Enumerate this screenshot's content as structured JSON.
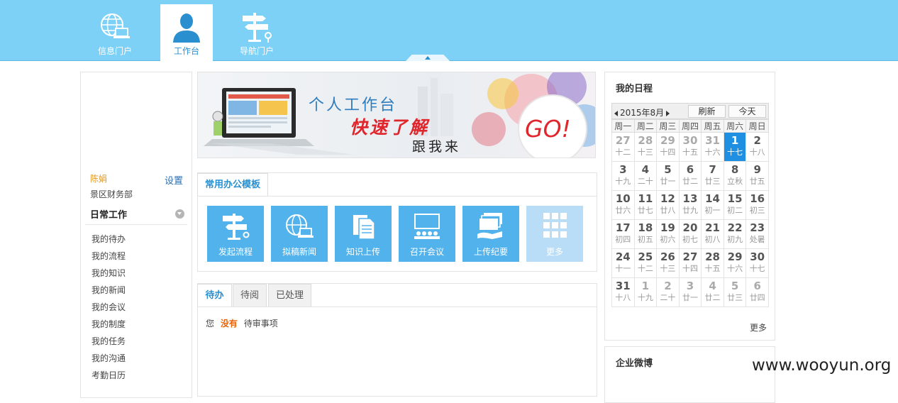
{
  "nav": {
    "tabs": [
      {
        "label": "信息门户",
        "icon": "globe-laptop-icon"
      },
      {
        "label": "工作台",
        "icon": "user-icon",
        "active": true
      },
      {
        "label": "导航门户",
        "icon": "signpost-icon"
      }
    ]
  },
  "user": {
    "name": "陈娟",
    "settings": "设置",
    "dept": "景区财务部"
  },
  "sidebar": {
    "section": "日常工作",
    "items": [
      "我的待办",
      "我的流程",
      "我的知识",
      "我的新闻",
      "我的会议",
      "我的制度",
      "我的任务",
      "我的沟通",
      "考勤日历"
    ]
  },
  "banner": {
    "line1": "个人工作台",
    "line2": "快速了解",
    "line3": "跟我来",
    "go": "GO!"
  },
  "templates": {
    "title": "常用办公模板",
    "tiles": [
      {
        "label": "发起流程",
        "icon": "signpost-icon"
      },
      {
        "label": "拟稿新闻",
        "icon": "globe-laptop-icon"
      },
      {
        "label": "知识上传",
        "icon": "document-icon"
      },
      {
        "label": "召开会议",
        "icon": "meeting-icon"
      },
      {
        "label": "上传纪要",
        "icon": "upload-minutes-icon"
      },
      {
        "label": "更多",
        "icon": "grid-icon"
      }
    ]
  },
  "tasks": {
    "tabs": [
      "待办",
      "待阅",
      "已处理"
    ],
    "msg_prefix": "您",
    "msg_highlight": "没有",
    "msg_suffix": "待审事项"
  },
  "schedule": {
    "title": "我的日程",
    "month": "2015年8月",
    "refresh": "刷新",
    "today": "今天",
    "weekdays": [
      "周一",
      "周二",
      "周三",
      "周四",
      "周五",
      "周六",
      "周日"
    ],
    "weeks": [
      [
        {
          "d": "27",
          "l": "十二",
          "o": true
        },
        {
          "d": "28",
          "l": "十三",
          "o": true
        },
        {
          "d": "29",
          "l": "十四",
          "o": true
        },
        {
          "d": "30",
          "l": "十五",
          "o": true
        },
        {
          "d": "31",
          "l": "十六",
          "o": true
        },
        {
          "d": "1",
          "l": "十七",
          "t": true
        },
        {
          "d": "2",
          "l": "十八"
        }
      ],
      [
        {
          "d": "3",
          "l": "十九"
        },
        {
          "d": "4",
          "l": "二十"
        },
        {
          "d": "5",
          "l": "廿一"
        },
        {
          "d": "6",
          "l": "廿二"
        },
        {
          "d": "7",
          "l": "廿三"
        },
        {
          "d": "8",
          "l": "立秋"
        },
        {
          "d": "9",
          "l": "廿五"
        }
      ],
      [
        {
          "d": "10",
          "l": "廿六"
        },
        {
          "d": "11",
          "l": "廿七"
        },
        {
          "d": "12",
          "l": "廿八"
        },
        {
          "d": "13",
          "l": "廿九"
        },
        {
          "d": "14",
          "l": "初一"
        },
        {
          "d": "15",
          "l": "初二"
        },
        {
          "d": "16",
          "l": "初三"
        }
      ],
      [
        {
          "d": "17",
          "l": "初四"
        },
        {
          "d": "18",
          "l": "初五"
        },
        {
          "d": "19",
          "l": "初六"
        },
        {
          "d": "20",
          "l": "初七"
        },
        {
          "d": "21",
          "l": "初八"
        },
        {
          "d": "22",
          "l": "初九"
        },
        {
          "d": "23",
          "l": "处暑"
        }
      ],
      [
        {
          "d": "24",
          "l": "十一"
        },
        {
          "d": "25",
          "l": "十二"
        },
        {
          "d": "26",
          "l": "十三"
        },
        {
          "d": "27",
          "l": "十四"
        },
        {
          "d": "28",
          "l": "十五"
        },
        {
          "d": "29",
          "l": "十六"
        },
        {
          "d": "30",
          "l": "十七"
        }
      ],
      [
        {
          "d": "31",
          "l": "十八"
        },
        {
          "d": "1",
          "l": "十九",
          "o": true
        },
        {
          "d": "2",
          "l": "二十",
          "o": true
        },
        {
          "d": "3",
          "l": "廿一",
          "o": true
        },
        {
          "d": "4",
          "l": "廿二",
          "o": true
        },
        {
          "d": "5",
          "l": "廿三",
          "o": true
        },
        {
          "d": "6",
          "l": "廿四",
          "o": true
        }
      ]
    ],
    "more": "更多"
  },
  "weibo": {
    "title": "企业微博"
  },
  "watermark": "www.wooyun.org",
  "colors": {
    "topbar": "#7ed1f6",
    "accent": "#2a8fce",
    "tile": "#52b2ec",
    "today": "#1e8fe1",
    "highlight": "#e8650c"
  }
}
